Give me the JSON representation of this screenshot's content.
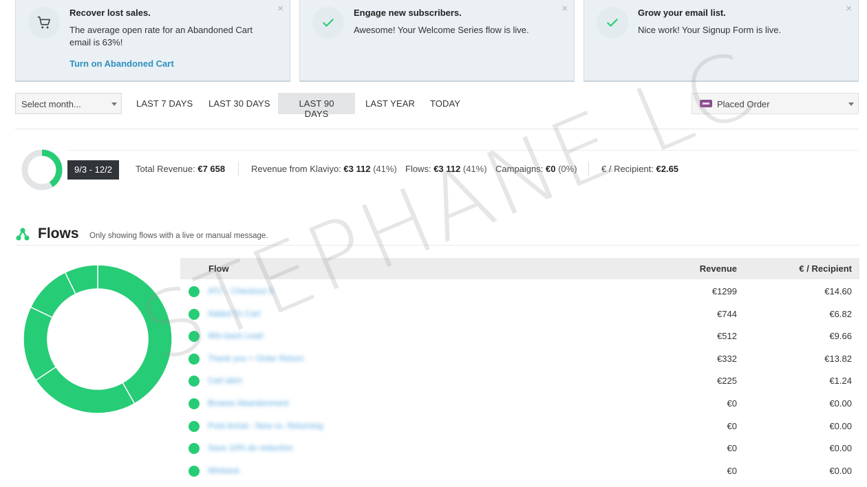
{
  "cards": [
    {
      "title": "Recover lost sales.",
      "text": "The average open rate for an Abandoned Cart email is 63%!",
      "link": "Turn on Abandoned Cart",
      "icon": "cart-icon"
    },
    {
      "title": "Engage new subscribers.",
      "text": "Awesome! Your Welcome Series flow is live.",
      "icon": "checkmark-icon"
    },
    {
      "title": "Grow your email list.",
      "text": "Nice work! Your Signup Form is live.",
      "icon": "checkmark-icon"
    }
  ],
  "close_glyph": "×",
  "filters": {
    "select_month": "Select month...",
    "ranges": [
      "LAST 7 DAYS",
      "LAST 30 DAYS",
      "LAST 90 DAYS",
      "LAST YEAR",
      "TODAY"
    ],
    "active_range": "LAST 90 DAYS",
    "metric": "Placed Order",
    "metric_icon": "woocommerce-icon"
  },
  "summary": {
    "date_range": "9/3 - 12/2",
    "donut_share": 0.41,
    "total_revenue_label": "Total Revenue:",
    "total_revenue": "€7 658",
    "klaviyo_label": "Revenue from Klaviyo:",
    "klaviyo_value": "€3 112",
    "klaviyo_pct": "(41%)",
    "flows_label": "Flows:",
    "flows_value": "€3 112",
    "flows_pct": "(41%)",
    "campaigns_label": "Campaigns:",
    "campaigns_value": "€0",
    "campaigns_pct": "(0%)",
    "per_recipient_label": "€ / Recipient:",
    "per_recipient_value": "€2.65"
  },
  "flows": {
    "title": "Flows",
    "subtitle": "Only showing flows with a live or manual message.",
    "icon": "flow-icon",
    "columns": {
      "flow": "Flow",
      "revenue": "Revenue",
      "per_recipient": "€ / Recipient"
    },
    "rows": [
      {
        "name": "ATC - Checkout S",
        "revenue": "€1299",
        "revenue_value": 1299,
        "per_recipient": "€14.60"
      },
      {
        "name": "Added To Cart",
        "revenue": "€744",
        "revenue_value": 744,
        "per_recipient": "€6.82"
      },
      {
        "name": "Win-back Lead",
        "revenue": "€512",
        "revenue_value": 512,
        "per_recipient": "€9.66"
      },
      {
        "name": "Thank you + Order Return",
        "revenue": "€332",
        "revenue_value": 332,
        "per_recipient": "€13.82"
      },
      {
        "name": "Cart alert",
        "revenue": "€225",
        "revenue_value": 225,
        "per_recipient": "€1.24"
      },
      {
        "name": "Browse Abandonment",
        "revenue": "€0",
        "revenue_value": 0,
        "per_recipient": "€0.00"
      },
      {
        "name": "Post-Achat - New vs. Returning",
        "revenue": "€0",
        "revenue_value": 0,
        "per_recipient": "€0.00"
      },
      {
        "name": "Save 10% de reduction",
        "revenue": "€0",
        "revenue_value": 0,
        "per_recipient": "€0.00"
      },
      {
        "name": "Winback",
        "revenue": "€0",
        "revenue_value": 0,
        "per_recipient": "€0.00"
      }
    ]
  },
  "colors": {
    "accent_green": "#27cc76",
    "link_blue": "#2f8fbf",
    "donut_track": "#e2e4e6"
  },
  "watermark": "STEPHANE LC"
}
